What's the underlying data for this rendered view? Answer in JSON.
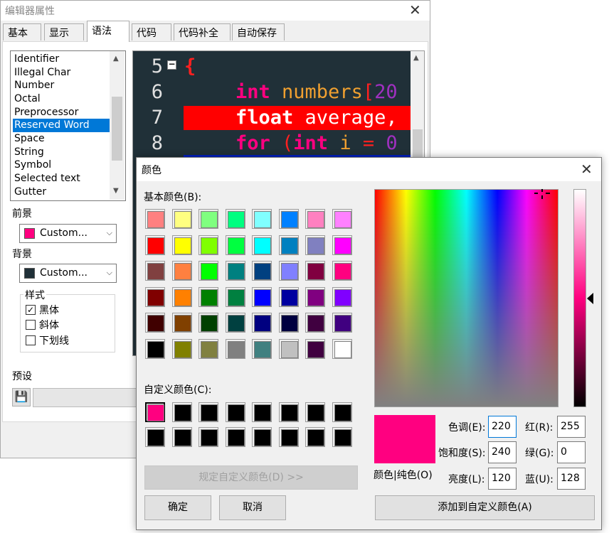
{
  "props_window": {
    "title": "编辑器属性",
    "tabs": [
      "基本",
      "显示",
      "语法",
      "代码",
      "代码补全",
      "自动保存"
    ],
    "active_tab": "语法",
    "elements_list": [
      "Identifier",
      "Illegal Char",
      "Number",
      "Octal",
      "Preprocessor",
      "Reserved Word",
      "Space",
      "String",
      "Symbol",
      "Selected text",
      "Gutter"
    ],
    "selected_element": "Reserved Word",
    "foreground_label": "前景",
    "foreground_value": "Custom...",
    "foreground_color": "#ff0080",
    "background_label": "背景",
    "background_value": "Custom...",
    "background_color": "#203038",
    "style_group": "样式",
    "style_options": [
      {
        "label": "黑体",
        "checked": true
      },
      {
        "label": "斜体",
        "checked": false
      },
      {
        "label": "下划线",
        "checked": false
      }
    ],
    "preset_label": "预设",
    "preview": {
      "line_numbers": [
        "5",
        "6",
        "7",
        "8"
      ],
      "fold_marker": "−",
      "line5": "{",
      "line6_kw": "int",
      "line6_rest": " numbers",
      "line6_bracket": "[",
      "line6_num": "20",
      "line7_kw": "float",
      "line7_rest": " average,",
      "line8_kw": "for",
      "line8_open": " (",
      "line8_kw2": "int",
      "line8_var": " i ",
      "line8_eq": "= ",
      "line8_num": "0"
    }
  },
  "color_dialog": {
    "title": "颜色",
    "basic_colors_label": "基本颜色(B):",
    "basic_colors": [
      "#ff8080",
      "#ffff80",
      "#80ff80",
      "#00ff80",
      "#80ffff",
      "#0080ff",
      "#ff80c0",
      "#ff80ff",
      "#ff0000",
      "#ffff00",
      "#80ff00",
      "#00ff40",
      "#00ffff",
      "#0080c0",
      "#8080c0",
      "#ff00ff",
      "#804040",
      "#ff8040",
      "#00ff00",
      "#008080",
      "#004080",
      "#8080ff",
      "#800040",
      "#ff0080",
      "#800000",
      "#ff8000",
      "#008000",
      "#008040",
      "#0000ff",
      "#0000a0",
      "#800080",
      "#8000ff",
      "#400000",
      "#804000",
      "#004000",
      "#004040",
      "#000080",
      "#000040",
      "#400040",
      "#400080",
      "#000000",
      "#808000",
      "#808040",
      "#808080",
      "#408080",
      "#c0c0c0",
      "#400040",
      "#ffffff"
    ],
    "custom_colors_label": "自定义颜色(C):",
    "custom_colors": [
      "#ff0080",
      "#000000",
      "#000000",
      "#000000",
      "#000000",
      "#000000",
      "#000000",
      "#000000",
      "#000000",
      "#000000",
      "#000000",
      "#000000",
      "#000000",
      "#000000",
      "#000000",
      "#000000"
    ],
    "define_custom_button": "规定自定义颜色(D) >>",
    "ok_button": "确定",
    "cancel_button": "取消",
    "color_solid_label": "颜色|纯色(O)",
    "current_color": "#ff0080",
    "hue_label": "色调(E):",
    "hue": "220",
    "sat_label": "饱和度(S):",
    "sat": "240",
    "lum_label": "亮度(L):",
    "lum": "120",
    "red_label": "红(R):",
    "red": "255",
    "green_label": "绿(G):",
    "green": "0",
    "blue_label": "蓝(U):",
    "blue": "128",
    "add_custom_button": "添加到自定义颜色(A)"
  }
}
